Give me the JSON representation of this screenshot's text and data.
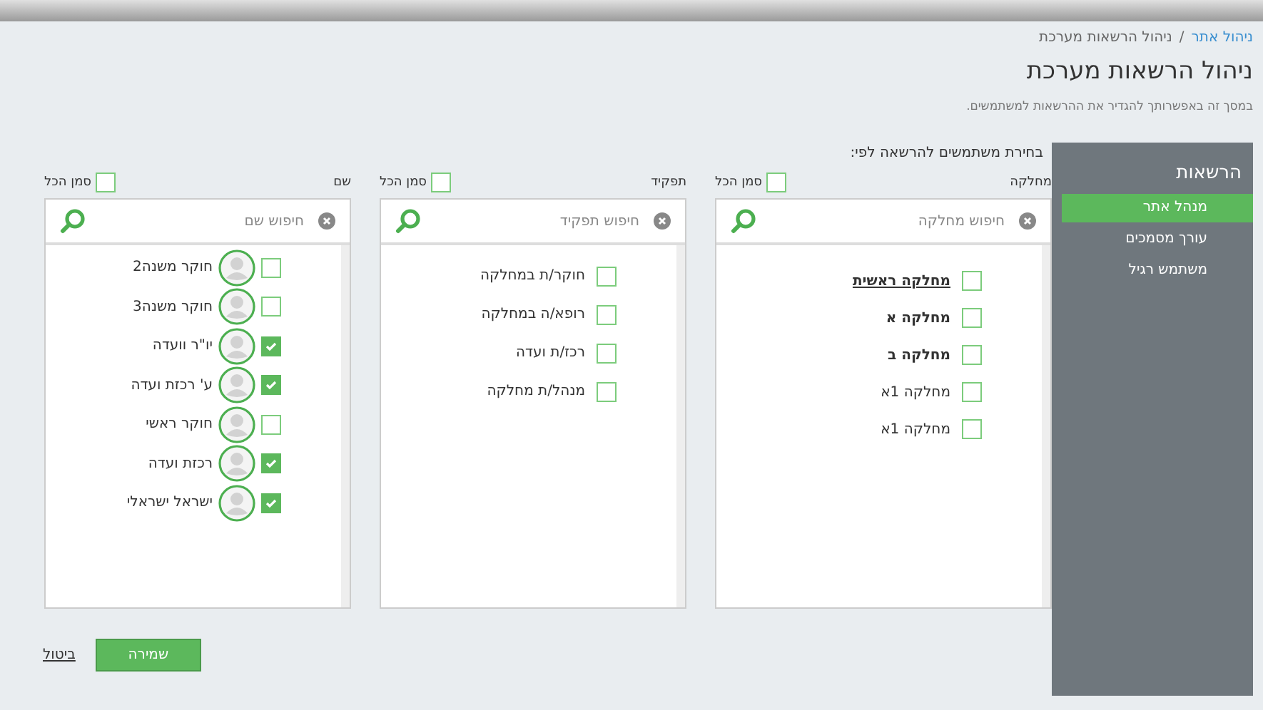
{
  "breadcrumb": [
    {
      "label": "ניהול אתר",
      "link": true
    },
    {
      "label": "ניהול הרשאות מערכת",
      "link": false
    }
  ],
  "breadcrumb_separator": "/",
  "title": "ניהול הרשאות מערכת",
  "subtitle": "במסך זה באפשרותך להגדיר את ההרשאות למשתמשים.",
  "sidebar": {
    "title": "הרשאות",
    "items": [
      {
        "label": "מנהל אתר",
        "selected": true
      },
      {
        "label": "עורך מסמכים",
        "selected": false
      },
      {
        "label": "משתמש רגיל",
        "selected": false
      }
    ]
  },
  "selection_label": "בחירת משתמשים להרשאה לפי:",
  "columns": [
    {
      "heading": "מחלקה",
      "select_all": {
        "label": "סמן הכל",
        "checked": false
      },
      "search": {
        "placeholder": "חיפוש מחלקה"
      },
      "avatars": false,
      "items": [
        {
          "label": "מחלקה ראשית",
          "kind": "heading",
          "checked": false
        },
        {
          "label": "מחלקה א",
          "kind": "bold",
          "checked": false
        },
        {
          "label": "מחלקה ב",
          "kind": "bold",
          "checked": false
        },
        {
          "label": "מחלקה 1א",
          "kind": "plain",
          "checked": false
        },
        {
          "label": "מחלקה 1א",
          "kind": "plain",
          "checked": false
        }
      ]
    },
    {
      "heading": "תפקיד",
      "select_all": {
        "label": "סמן הכל",
        "checked": false
      },
      "search": {
        "placeholder": "חיפוש תפקיד"
      },
      "avatars": false,
      "items": [
        {
          "label": "חוקר/ת במחלקה",
          "kind": "plain",
          "checked": false
        },
        {
          "label": "רופא/ה במחלקה",
          "kind": "plain",
          "checked": false
        },
        {
          "label": "רכז/ת ועדה",
          "kind": "plain",
          "checked": false
        },
        {
          "label": "מנהל/ת מחלקה",
          "kind": "plain",
          "checked": false
        }
      ]
    },
    {
      "heading": "שם",
      "select_all": {
        "label": "סמן הכל",
        "checked": false
      },
      "search": {
        "placeholder": "חיפוש שם"
      },
      "avatars": true,
      "items": [
        {
          "label": "חוקר משנה2",
          "kind": "plain",
          "checked": false
        },
        {
          "label": "חוקר משנה3",
          "kind": "plain",
          "checked": false
        },
        {
          "label": "יו\"ר וועדה",
          "kind": "plain",
          "checked": true
        },
        {
          "label": "ע' רכזת ועדה",
          "kind": "plain",
          "checked": true
        },
        {
          "label": "חוקר ראשי",
          "kind": "plain",
          "checked": false
        },
        {
          "label": "רכזת ועדה",
          "kind": "plain",
          "checked": true
        },
        {
          "label": "ישראל ישראלי",
          "kind": "plain",
          "checked": true
        }
      ]
    }
  ],
  "buttons": {
    "cancel": "ביטול",
    "save": "שמירה"
  }
}
